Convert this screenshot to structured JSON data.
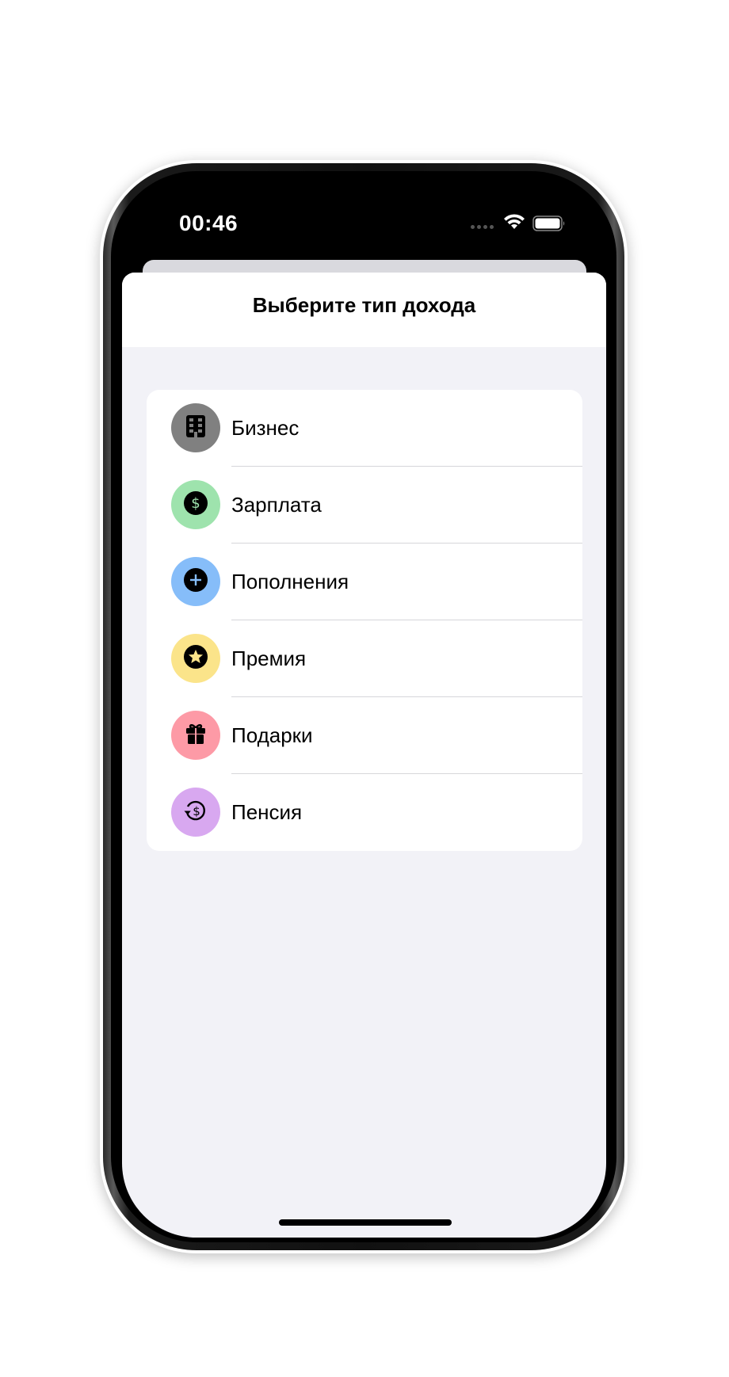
{
  "status_bar": {
    "time": "00:46",
    "signal_icon": "cellular-dots-icon",
    "wifi_icon": "wifi-icon",
    "battery_icon": "battery-icon"
  },
  "sheet": {
    "title": "Выберите тип дохода"
  },
  "income_types": [
    {
      "label": "Бизнес",
      "icon": "building-icon",
      "color": "#808080"
    },
    {
      "label": "Зарплата",
      "icon": "dollar-circle-icon",
      "color": "#9ee3ad"
    },
    {
      "label": "Пополнения",
      "icon": "plus-circle-icon",
      "color": "#86bdf9"
    },
    {
      "label": "Премия",
      "icon": "star-circle-icon",
      "color": "#fbe48a"
    },
    {
      "label": "Подарки",
      "icon": "gift-icon",
      "color": "#fd9aa6"
    },
    {
      "label": "Пенсия",
      "icon": "dollar-arrow-icon",
      "color": "#d8a8f0"
    }
  ],
  "colors": {
    "sheet_background": "#f2f2f7",
    "card_background": "#ffffff",
    "separator": "#d6d6da"
  }
}
